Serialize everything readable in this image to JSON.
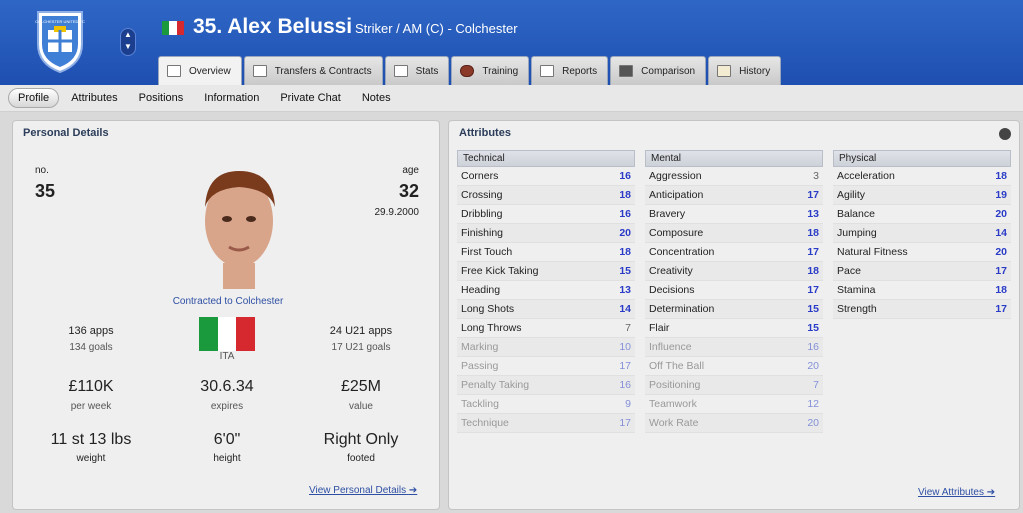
{
  "header": {
    "player_title": "35. Alex Belussi",
    "player_sub": "Striker / AM (C) - Colchester",
    "crest_text": "COLCHESTER UNITED FC"
  },
  "tabs": [
    "Overview",
    "Transfers & Contracts",
    "Stats",
    "Training",
    "Reports",
    "Comparison",
    "History"
  ],
  "subnav": [
    "Profile",
    "Attributes",
    "Positions",
    "Information",
    "Private Chat",
    "Notes"
  ],
  "personal": {
    "title": "Personal Details",
    "no_label": "no.",
    "no": "35",
    "age_label": "age",
    "age": "32",
    "dob": "29.9.2000",
    "contract": "Contracted to Colchester",
    "apps": "136 apps",
    "goals": "134 goals",
    "u21_apps": "24 U21 apps",
    "u21_goals": "17 U21 goals",
    "nation": "ITA",
    "wage": "£110K",
    "wage_cap": "per week",
    "expires": "30.6.34",
    "expires_cap": "expires",
    "value": "£25M",
    "value_cap": "value",
    "weight": "11 st 13 lbs",
    "weight_cap": "weight",
    "height": "6'0\"",
    "height_cap": "height",
    "foot": "Right Only",
    "foot_cap": "footed",
    "link": "View Personal Details"
  },
  "attributes": {
    "title": "Attributes",
    "link": "View Attributes",
    "technical_title": "Technical",
    "mental_title": "Mental",
    "physical_title": "Physical",
    "technical": [
      {
        "name": "Corners",
        "value": "16"
      },
      {
        "name": "Crossing",
        "value": "18"
      },
      {
        "name": "Dribbling",
        "value": "16"
      },
      {
        "name": "Finishing",
        "value": "20"
      },
      {
        "name": "First Touch",
        "value": "18"
      },
      {
        "name": "Free Kick Taking",
        "value": "15"
      },
      {
        "name": "Heading",
        "value": "13"
      },
      {
        "name": "Long Shots",
        "value": "14"
      },
      {
        "name": "Long Throws",
        "value": "7"
      },
      {
        "name": "Marking",
        "value": "10"
      },
      {
        "name": "Passing",
        "value": "17"
      },
      {
        "name": "Penalty Taking",
        "value": "16"
      },
      {
        "name": "Tackling",
        "value": "9"
      },
      {
        "name": "Technique",
        "value": "17"
      }
    ],
    "mental": [
      {
        "name": "Aggression",
        "value": "3"
      },
      {
        "name": "Anticipation",
        "value": "17"
      },
      {
        "name": "Bravery",
        "value": "13"
      },
      {
        "name": "Composure",
        "value": "18"
      },
      {
        "name": "Concentration",
        "value": "17"
      },
      {
        "name": "Creativity",
        "value": "18"
      },
      {
        "name": "Decisions",
        "value": "17"
      },
      {
        "name": "Determination",
        "value": "15"
      },
      {
        "name": "Flair",
        "value": "15"
      },
      {
        "name": "Influence",
        "value": "16"
      },
      {
        "name": "Off The Ball",
        "value": "20"
      },
      {
        "name": "Positioning",
        "value": "7"
      },
      {
        "name": "Teamwork",
        "value": "12"
      },
      {
        "name": "Work Rate",
        "value": "20"
      }
    ],
    "physical": [
      {
        "name": "Acceleration",
        "value": "18"
      },
      {
        "name": "Agility",
        "value": "19"
      },
      {
        "name": "Balance",
        "value": "20"
      },
      {
        "name": "Jumping",
        "value": "14"
      },
      {
        "name": "Natural Fitness",
        "value": "20"
      },
      {
        "name": "Pace",
        "value": "17"
      },
      {
        "name": "Stamina",
        "value": "18"
      },
      {
        "name": "Strength",
        "value": "17"
      }
    ]
  },
  "colors": {
    "header": "#2f67c6",
    "value_blue": "#2a3cc7",
    "link": "#2e4fa3"
  }
}
